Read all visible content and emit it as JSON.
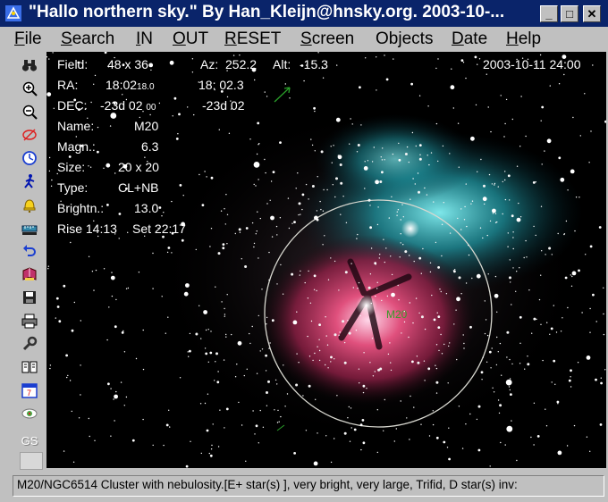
{
  "window": {
    "title": "\"Hallo northern sky.\"  By Han_Kleijn@hnsky.org.  2003-10-...",
    "minimize": "_",
    "maximize": "□",
    "close": "✕"
  },
  "menu": [
    {
      "key": "F",
      "rest": "ile"
    },
    {
      "key": "S",
      "rest": "earch"
    },
    {
      "key": "I",
      "rest": "N"
    },
    {
      "key": "O",
      "rest": "UT"
    },
    {
      "key": "R",
      "rest": "ESET"
    },
    {
      "key": "S",
      "rest": "creen",
      "pre": ""
    },
    {
      "key": "j",
      "rest": "ects",
      "pre": "Ob"
    },
    {
      "key": "D",
      "rest": "ate"
    },
    {
      "key": "H",
      "rest": "elp"
    }
  ],
  "toolbar": {
    "icons": [
      "binoculars-icon",
      "zoom-in-icon",
      "zoom-out-icon",
      "no-ring-icon",
      "clock-icon",
      "walking-man-icon",
      "bell-icon",
      "ruler-icon",
      "undo-icon",
      "book-icon",
      "save-icon",
      "print-icon",
      "wrench-icon",
      "atlas-icon",
      "calendar-icon",
      "eye-icon"
    ],
    "gs_label": "GS"
  },
  "info": {
    "field_label": "Field:",
    "field_value": "48  x  36",
    "az_label": "Az:",
    "az_value": "252.2",
    "alt_label": "Alt:",
    "alt_value": "-15.3",
    "datetime": "2003-10-11  24:00",
    "ra_label": "RA:",
    "ra_value": "18:02",
    "ra_small": "18.0",
    "ra_value2": "18: 02.3",
    "dec_label": "DEC:",
    "dec_value": "-23d 02",
    "dec_small": "00",
    "dec_value2": "-23d 02",
    "name_label": "Name:",
    "name_value": "M20",
    "magn_label": "Magn.:",
    "magn_value": "6.3",
    "size_label": "Size:",
    "size_value": "20 x 20",
    "type_label": "Type:",
    "type_value": "CL+NB",
    "bright_label": "Brightn.:",
    "bright_value": "13.0",
    "rise_label": "Rise 14:13",
    "set_label": "Set 22:17",
    "object_label": "M20"
  },
  "colors": {
    "titlebar": "#0a246a",
    "sky": "#000000",
    "ring": "#d8d8d0",
    "nebula_red": "#d6336d",
    "nebula_blue": "#2ec0c8"
  },
  "status": {
    "text": "M20/NGC6514   Cluster with nebulosity.[E+ star(s) ], very bright, very large, Trifid, D star(s)  inv:"
  }
}
